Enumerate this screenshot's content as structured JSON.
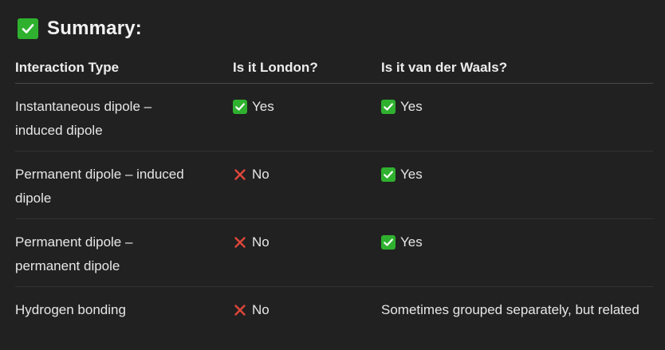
{
  "heading": {
    "icon": "check-mark-button-icon",
    "title": "Summary:"
  },
  "colors": {
    "background": "#212121",
    "check_green": "#2fb12f",
    "cross_red": "#e0473a",
    "text": "#ececec"
  },
  "table": {
    "headers": [
      "Interaction Type",
      "Is it London?",
      "Is it van der Waals?"
    ],
    "rows": [
      {
        "type": "Instantaneous dipole – induced dipole",
        "london": {
          "icon": "check-mark-icon",
          "text": "Yes"
        },
        "vdw": {
          "icon": "check-mark-icon",
          "text": "Yes"
        }
      },
      {
        "type": "Permanent dipole – induced dipole",
        "london": {
          "icon": "cross-mark-icon",
          "text": "No"
        },
        "vdw": {
          "icon": "check-mark-icon",
          "text": "Yes"
        }
      },
      {
        "type": "Permanent dipole – permanent dipole",
        "london": {
          "icon": "cross-mark-icon",
          "text": "No"
        },
        "vdw": {
          "icon": "check-mark-icon",
          "text": "Yes"
        }
      },
      {
        "type": "Hydrogen bonding",
        "london": {
          "icon": "cross-mark-icon",
          "text": "No"
        },
        "vdw": {
          "icon": "",
          "text": "Sometimes grouped separately, but related"
        }
      }
    ]
  }
}
